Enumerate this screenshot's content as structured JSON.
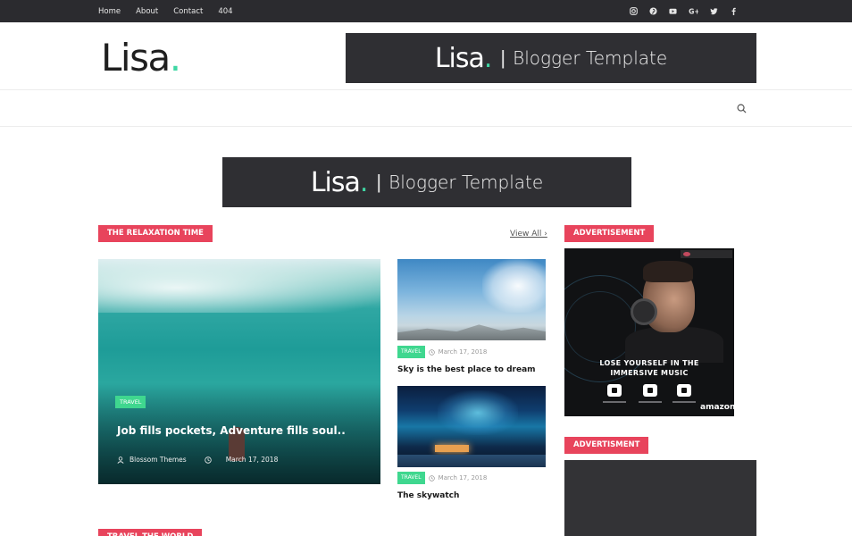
{
  "topbar": {
    "nav": [
      "Home",
      "About",
      "Contact",
      "404"
    ],
    "social_icons": [
      "instagram-icon",
      "pinterest-icon",
      "youtube-icon",
      "google-plus-icon",
      "twitter-icon",
      "facebook-icon"
    ]
  },
  "header": {
    "logo_text": "Lisa",
    "logo_dot": ".",
    "banner": {
      "logo": "Lisa",
      "dot": ".",
      "separator": "|",
      "tagline": "Blogger Template"
    }
  },
  "colors": {
    "accent_red": "#e8445c",
    "accent_green": "#3fd78f",
    "dark": "#2f2f33"
  },
  "mid_banner": {
    "logo": "Lisa",
    "dot": ".",
    "separator": "|",
    "tagline": "Blogger Template"
  },
  "section1": {
    "tag": "THE RELAXATION TIME",
    "view_all": "View All ›",
    "featured": {
      "category": "TRAVEL",
      "title": "Job fills pockets, Adventure fills soul..",
      "author": "Blossom Themes",
      "date": "March 17, 2018"
    },
    "posts": [
      {
        "category": "TRAVEL",
        "date": "March 17, 2018",
        "title": "Sky is the best place to dream"
      },
      {
        "category": "TRAVEL",
        "date": "March 17, 2018",
        "title": "The skywatch"
      }
    ]
  },
  "sidebar": {
    "ad1_tag": "ADVERTISEMENT",
    "ad1": {
      "line1": "LOSE YOURSELF IN THE",
      "line2": "IMMERSIVE MUSIC",
      "brand": "amazon"
    },
    "ad2_tag": "ADVERTISMENT"
  },
  "section2": {
    "tag": "TRAVEL THE WORLD"
  }
}
